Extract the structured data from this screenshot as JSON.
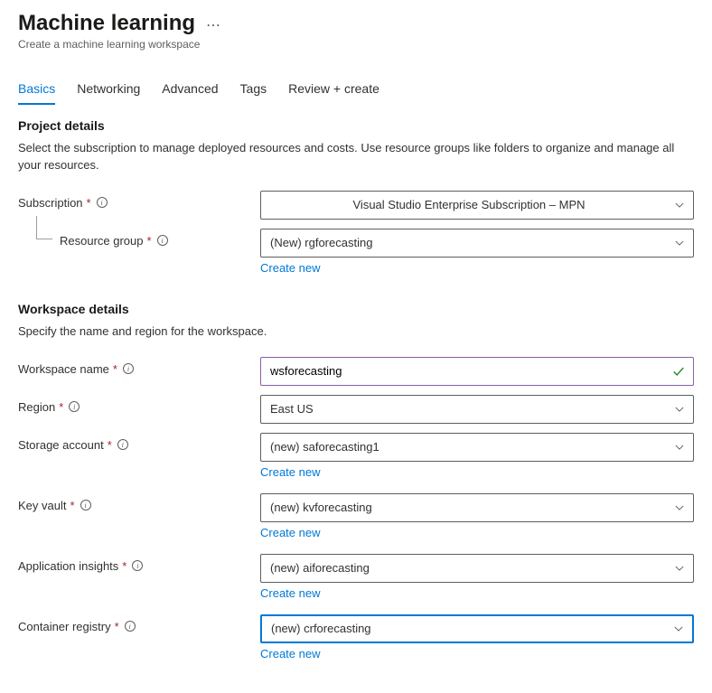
{
  "header": {
    "title": "Machine learning",
    "subtitle": "Create a machine learning workspace"
  },
  "tabs": [
    {
      "label": "Basics",
      "active": true
    },
    {
      "label": "Networking",
      "active": false
    },
    {
      "label": "Advanced",
      "active": false
    },
    {
      "label": "Tags",
      "active": false
    },
    {
      "label": "Review + create",
      "active": false
    }
  ],
  "sections": {
    "project": {
      "title": "Project details",
      "desc": "Select the subscription to manage deployed resources and costs. Use resource groups like folders to organize and manage all your resources."
    },
    "workspace": {
      "title": "Workspace details",
      "desc": "Specify the name and region for the workspace."
    }
  },
  "fields": {
    "subscription": {
      "label": "Subscription",
      "value": "Visual Studio Enterprise Subscription – MPN"
    },
    "resourceGroup": {
      "label": "Resource group",
      "value": "(New) rgforecasting",
      "createNew": "Create new"
    },
    "workspaceName": {
      "label": "Workspace name",
      "value": "wsforecasting"
    },
    "region": {
      "label": "Region",
      "value": "East US"
    },
    "storageAccount": {
      "label": "Storage account",
      "value": "(new) saforecasting1",
      "createNew": "Create new"
    },
    "keyVault": {
      "label": "Key vault",
      "value": "(new) kvforecasting",
      "createNew": "Create new"
    },
    "appInsights": {
      "label": "Application insights",
      "value": "(new) aiforecasting",
      "createNew": "Create new"
    },
    "containerRegistry": {
      "label": "Container registry",
      "value": "(new) crforecasting",
      "createNew": "Create new"
    }
  }
}
